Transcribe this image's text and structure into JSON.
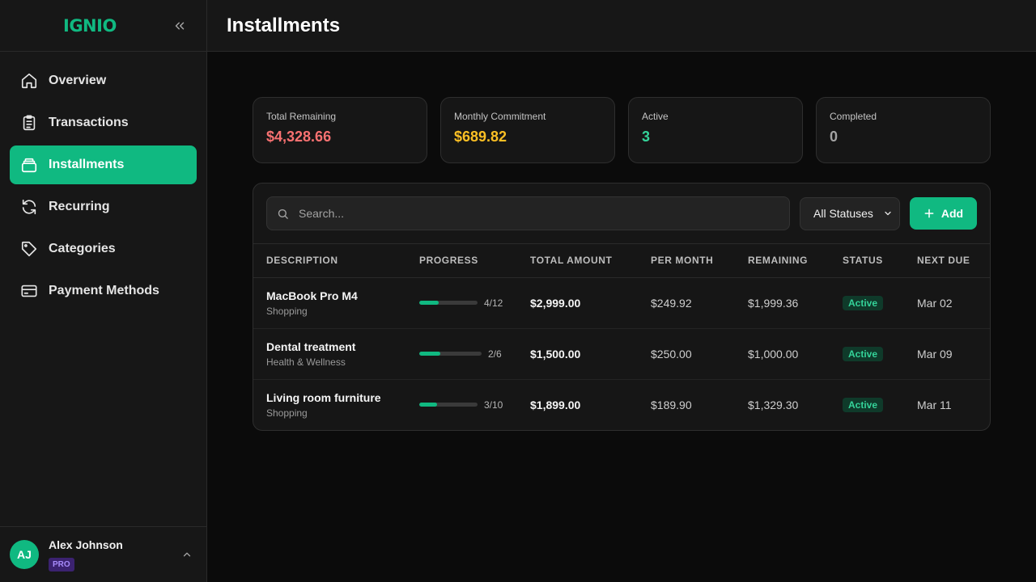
{
  "app": {
    "logo": "IGNIO"
  },
  "header": {
    "title": "Installments"
  },
  "sidebar": {
    "items": [
      {
        "label": "Overview",
        "icon": "home-icon"
      },
      {
        "label": "Transactions",
        "icon": "clipboard-icon"
      },
      {
        "label": "Installments",
        "icon": "layers-icon",
        "active": true
      },
      {
        "label": "Recurring",
        "icon": "refresh-icon"
      },
      {
        "label": "Categories",
        "icon": "tag-icon"
      },
      {
        "label": "Payment Methods",
        "icon": "credit-card-icon"
      }
    ],
    "user": {
      "initials": "AJ",
      "name": "Alex Johnson",
      "plan": "PRO"
    }
  },
  "stats": [
    {
      "label": "Total Remaining",
      "value": "$4,328.66",
      "color": "#f87171"
    },
    {
      "label": "Monthly Commitment",
      "value": "$689.82",
      "color": "#fbbf24"
    },
    {
      "label": "Active",
      "value": "3",
      "color": "#34d399"
    },
    {
      "label": "Completed",
      "value": "0",
      "color": "#a3a3a3"
    }
  ],
  "toolbar": {
    "search_placeholder": "Search...",
    "status_filter": "All Statuses",
    "add_label": "Add"
  },
  "table": {
    "columns": [
      "DESCRIPTION",
      "PROGRESS",
      "TOTAL AMOUNT",
      "PER MONTH",
      "REMAINING",
      "STATUS",
      "NEXT DUE"
    ],
    "rows": [
      {
        "title": "MacBook Pro M4",
        "category": "Shopping",
        "progress_text": "4/12",
        "progress": 0.333,
        "total": "$2,999.00",
        "per_month": "$249.92",
        "remaining": "$1,999.36",
        "status": "Active",
        "next_due": "Mar 02"
      },
      {
        "title": "Dental treatment",
        "category": "Health & Wellness",
        "progress_text": "2/6",
        "progress": 0.333,
        "total": "$1,500.00",
        "per_month": "$250.00",
        "remaining": "$1,000.00",
        "status": "Active",
        "next_due": "Mar 09"
      },
      {
        "title": "Living room furniture",
        "category": "Shopping",
        "progress_text": "3/10",
        "progress": 0.3,
        "total": "$1,899.00",
        "per_month": "$189.90",
        "remaining": "$1,329.30",
        "status": "Active",
        "next_due": "Mar 11"
      }
    ]
  }
}
